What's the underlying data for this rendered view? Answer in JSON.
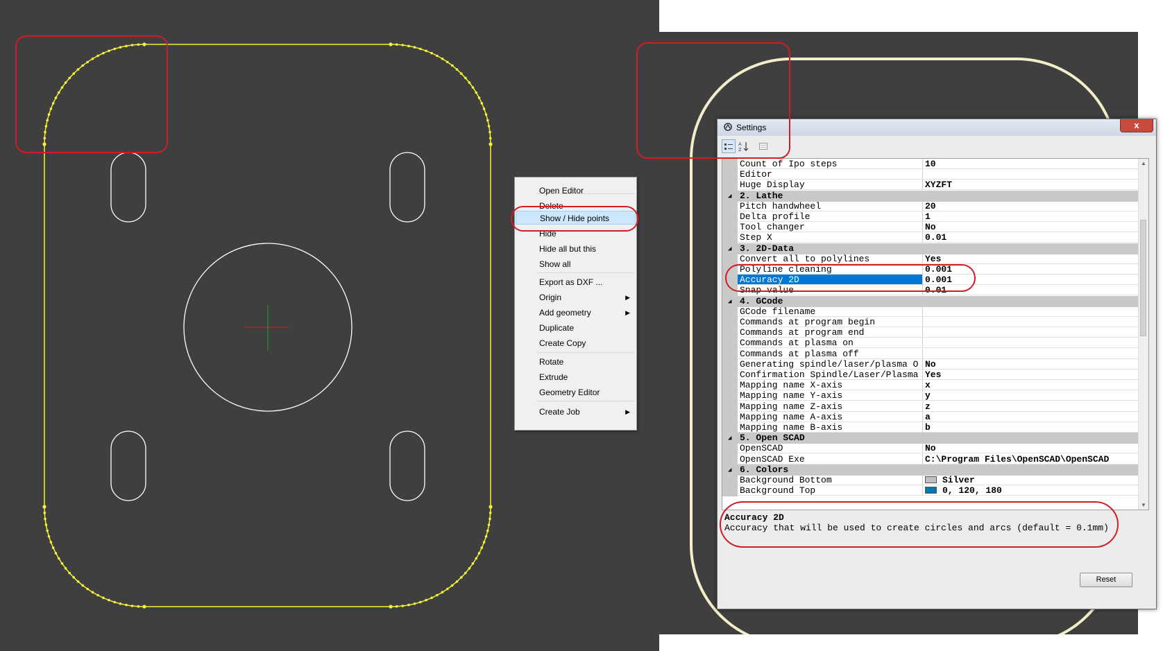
{
  "context_menu": {
    "items": [
      {
        "label": "Open Editor",
        "submenu": false
      },
      {
        "label": "Delete",
        "submenu": false
      },
      {
        "label": "Show / Hide points",
        "submenu": false,
        "selected": true
      },
      {
        "label": "Hide",
        "submenu": false
      },
      {
        "label": "Hide all but this",
        "submenu": false
      },
      {
        "label": "Show all",
        "submenu": false
      },
      {
        "label": "Export as DXF ...",
        "submenu": false
      },
      {
        "label": "Origin",
        "submenu": true
      },
      {
        "label": "Add geometry",
        "submenu": true
      },
      {
        "label": "Duplicate",
        "submenu": false
      },
      {
        "label": "Create Copy",
        "submenu": false
      },
      {
        "label": "Rotate",
        "submenu": false
      },
      {
        "label": "Extrude",
        "submenu": false
      },
      {
        "label": "Geometry Editor",
        "submenu": false
      },
      {
        "label": "Create Job",
        "submenu": true
      }
    ]
  },
  "settings": {
    "title": "Settings",
    "close_label": "x",
    "toolbar": {
      "categorized_icon": "categorized-icon",
      "alpha_icon": "sort-alpha-icon",
      "pages_icon": "property-pages-icon"
    },
    "rows": [
      {
        "type": "prop",
        "name": "Count of Ipo steps",
        "value": "10"
      },
      {
        "type": "prop",
        "name": "Editor",
        "value": ""
      },
      {
        "type": "prop",
        "name": "Huge Display",
        "value": "XYZFT"
      },
      {
        "type": "cat",
        "name": "2. Lathe"
      },
      {
        "type": "prop",
        "name": "Pitch handwheel",
        "value": "20"
      },
      {
        "type": "prop",
        "name": "Delta profile",
        "value": "1"
      },
      {
        "type": "prop",
        "name": "Tool changer",
        "value": "No"
      },
      {
        "type": "prop",
        "name": "Step X",
        "value": "0.01"
      },
      {
        "type": "cat",
        "name": "3. 2D-Data"
      },
      {
        "type": "prop",
        "name": "Convert all to polylines",
        "value": "Yes"
      },
      {
        "type": "prop",
        "name": "Polyline cleaning",
        "value": "0.001"
      },
      {
        "type": "prop",
        "name": "Accuracy 2D",
        "value": "0.001",
        "selected": true
      },
      {
        "type": "prop",
        "name": "Snap value",
        "value": "0.01"
      },
      {
        "type": "cat",
        "name": "4. GCode"
      },
      {
        "type": "prop",
        "name": "GCode filename",
        "value": ""
      },
      {
        "type": "prop",
        "name": "Commands at program begin",
        "value": ""
      },
      {
        "type": "prop",
        "name": "Commands at program end",
        "value": ""
      },
      {
        "type": "prop",
        "name": "Commands at plasma on",
        "value": ""
      },
      {
        "type": "prop",
        "name": "Commands at plasma off",
        "value": ""
      },
      {
        "type": "prop",
        "name": "Generating spindle/laser/plasma O",
        "value": "No"
      },
      {
        "type": "prop",
        "name": "Confirmation Spindle/Laser/Plasma",
        "value": "Yes"
      },
      {
        "type": "prop",
        "name": "Mapping name X-axis",
        "value": "x"
      },
      {
        "type": "prop",
        "name": "Mapping name Y-axis",
        "value": "y"
      },
      {
        "type": "prop",
        "name": "Mapping name Z-axis",
        "value": "z"
      },
      {
        "type": "prop",
        "name": "Mapping name A-axis",
        "value": "a"
      },
      {
        "type": "prop",
        "name": "Mapping name B-axis",
        "value": "b"
      },
      {
        "type": "cat",
        "name": "5. Open SCAD"
      },
      {
        "type": "prop",
        "name": "OpenSCAD",
        "value": "No"
      },
      {
        "type": "prop",
        "name": "OpenSCAD Exe",
        "value": "C:\\Program Files\\OpenSCAD\\OpenSCAD"
      },
      {
        "type": "cat",
        "name": "6. Colors"
      },
      {
        "type": "prop",
        "name": "Background Bottom",
        "value": "Silver",
        "swatch": "#c0c0c0"
      },
      {
        "type": "prop",
        "name": "Background Top",
        "value": "0, 120, 180",
        "swatch": "#0078b4"
      }
    ],
    "description": {
      "title": "Accuracy 2D",
      "text": "Accuracy that will be used to create circles and arcs (default = 0.1mm)"
    },
    "reset_label": "Reset"
  },
  "colors": {
    "canvas": "#3f3f3f",
    "contour_yellow": "#f5f23a",
    "contour_cream": "#f2eec8",
    "annotation_red": "#d01c25",
    "selection_blue": "#0078d7"
  }
}
